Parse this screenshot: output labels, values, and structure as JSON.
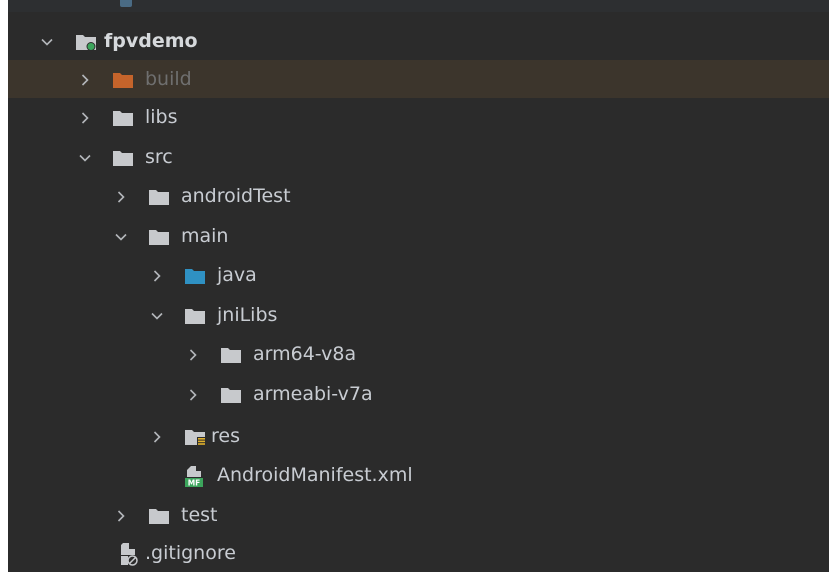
{
  "project_tree": {
    "items": [
      {
        "label": "fpvdemo",
        "expanded": true,
        "icon": "module-folder-icon",
        "bold": true
      },
      {
        "label": "build",
        "expanded": false,
        "icon": "excluded-folder-icon",
        "highlighted": true
      },
      {
        "label": "libs",
        "expanded": false,
        "icon": "folder-icon"
      },
      {
        "label": "src",
        "expanded": true,
        "icon": "folder-icon"
      },
      {
        "label": "androidTest",
        "expanded": false,
        "icon": "folder-icon"
      },
      {
        "label": "main",
        "expanded": true,
        "icon": "folder-icon"
      },
      {
        "label": "java",
        "expanded": false,
        "icon": "source-folder-icon"
      },
      {
        "label": "jniLibs",
        "expanded": true,
        "icon": "folder-icon"
      },
      {
        "label": "arm64-v8a",
        "expanded": false,
        "icon": "folder-icon"
      },
      {
        "label": "armeabi-v7a",
        "expanded": false,
        "icon": "folder-icon"
      },
      {
        "label": "res",
        "expanded": false,
        "icon": "resource-folder-icon"
      },
      {
        "label": "AndroidManifest.xml",
        "icon": "manifest-file-icon"
      },
      {
        "label": "test",
        "expanded": false,
        "icon": "folder-icon"
      },
      {
        "label": ".gitignore",
        "icon": "ignore-file-icon"
      }
    ]
  },
  "colors": {
    "panel_background": "#2b2b2b",
    "highlight_row": "#3c352c",
    "folder": "#c7c9cc",
    "excluded_folder": "#c5642b",
    "source_folder": "#2f91c3",
    "module_dot": "#3ca55c",
    "text": "#c8ccd2",
    "text_excluded": "#6f6f6f"
  }
}
